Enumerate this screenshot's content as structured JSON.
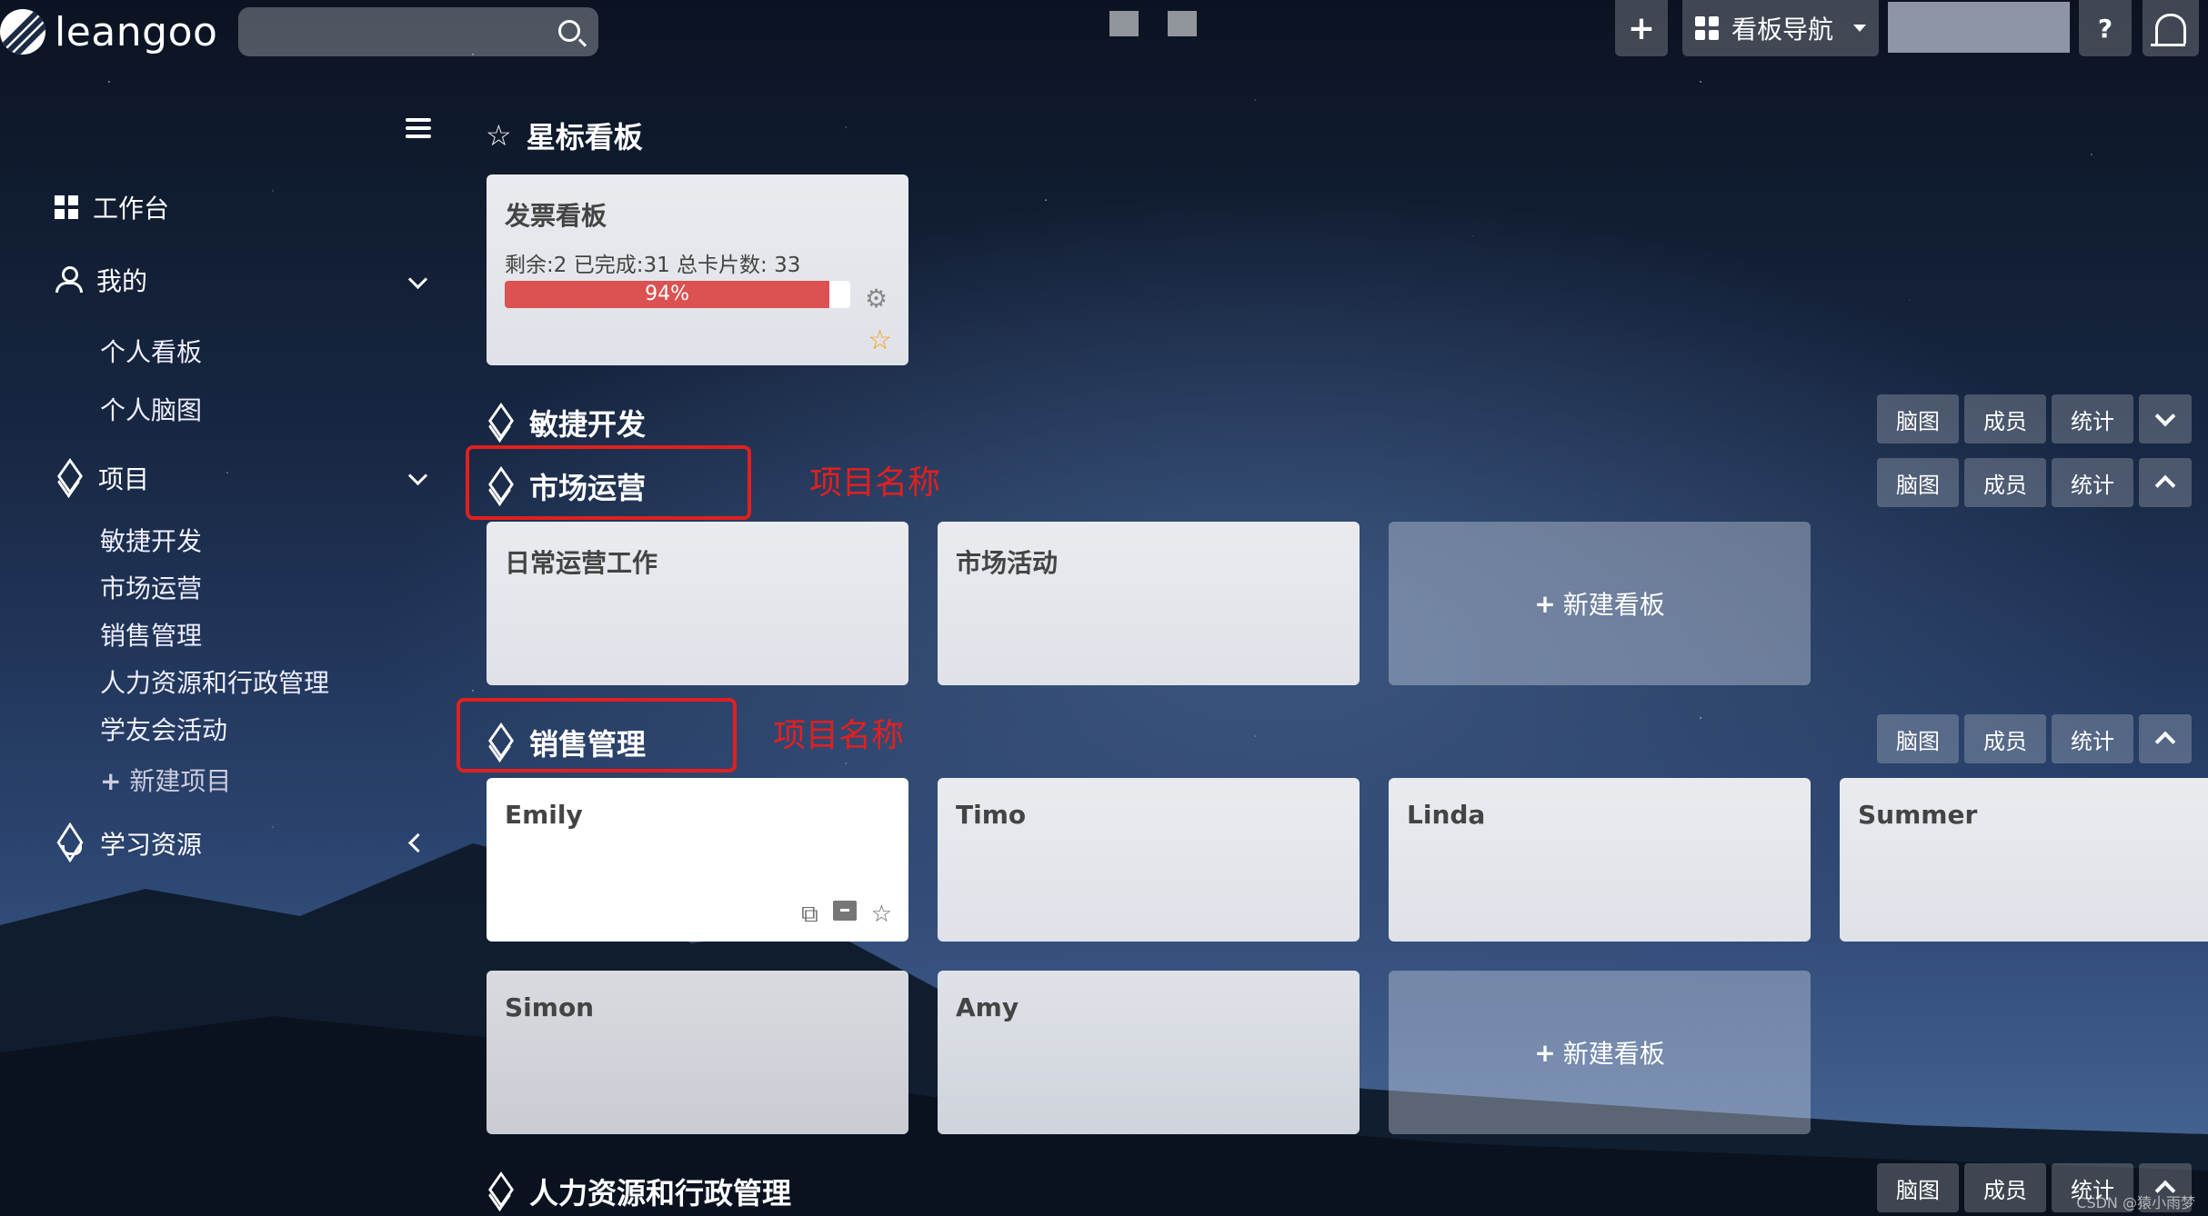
{
  "brand": {
    "name": "leangoo"
  },
  "topbar": {
    "add_label": "+",
    "board_nav_label": "看板导航",
    "help_label": "?"
  },
  "sidebar": {
    "workbench": "工作台",
    "mine": "我的",
    "mine_items": [
      "个人看板",
      "个人脑图"
    ],
    "projects": "项目",
    "project_items": [
      "敏捷开发",
      "市场运营",
      "销售管理",
      "人力资源和行政管理",
      "学友会活动"
    ],
    "new_project": "新建项目",
    "learning": "学习资源"
  },
  "starred": {
    "heading": "星标看板",
    "board": {
      "title": "发票看板",
      "stats": "剩余:2  已完成:31  总卡片数: 33",
      "progress_label": "94%",
      "progress": 0.94
    }
  },
  "project_buttons": {
    "mindmap": "脑图",
    "members": "成员",
    "stats": "统计"
  },
  "projects": [
    {
      "name": "敏捷开发"
    },
    {
      "name": "市场运营",
      "boards": [
        "日常运营工作",
        "市场活动"
      ]
    },
    {
      "name": "销售管理",
      "boards": [
        "Emily",
        "Timo",
        "Linda",
        "Summer",
        "Simon",
        "Amy"
      ]
    },
    {
      "name": "人力资源和行政管理"
    }
  ],
  "new_board_label": "新建看板",
  "annotations": {
    "label": "项目名称",
    "color": "#e02020"
  },
  "watermark": "CSDN @猿小雨梦",
  "colors": {
    "progress": "#dc5151",
    "star": "#f3a01a"
  }
}
